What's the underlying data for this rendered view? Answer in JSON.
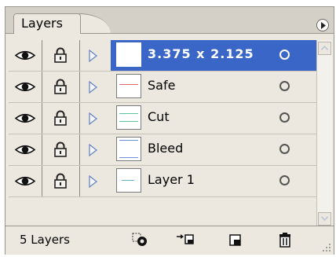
{
  "panel": {
    "tab_label": "Layers",
    "layer_count": "5 Layers"
  },
  "layers": [
    {
      "name": "3.375 x 2.125",
      "selected": true,
      "thumb_color": "#ffffff"
    },
    {
      "name": "Safe",
      "selected": false,
      "thumb_color": "#e06a6a"
    },
    {
      "name": "Cut",
      "selected": false,
      "thumb_color": "#5fc29a"
    },
    {
      "name": "Bleed",
      "selected": false,
      "thumb_color": "#6b8fd6"
    },
    {
      "name": "Layer 1",
      "selected": false,
      "thumb_color": "#5fb0c2"
    }
  ],
  "footer_icons": [
    "clipping-mask-icon",
    "new-sublayer-icon",
    "new-layer-icon",
    "trash-icon"
  ],
  "colors": {
    "selection": "#3a66c8",
    "panel_bg": "#ece8df"
  }
}
